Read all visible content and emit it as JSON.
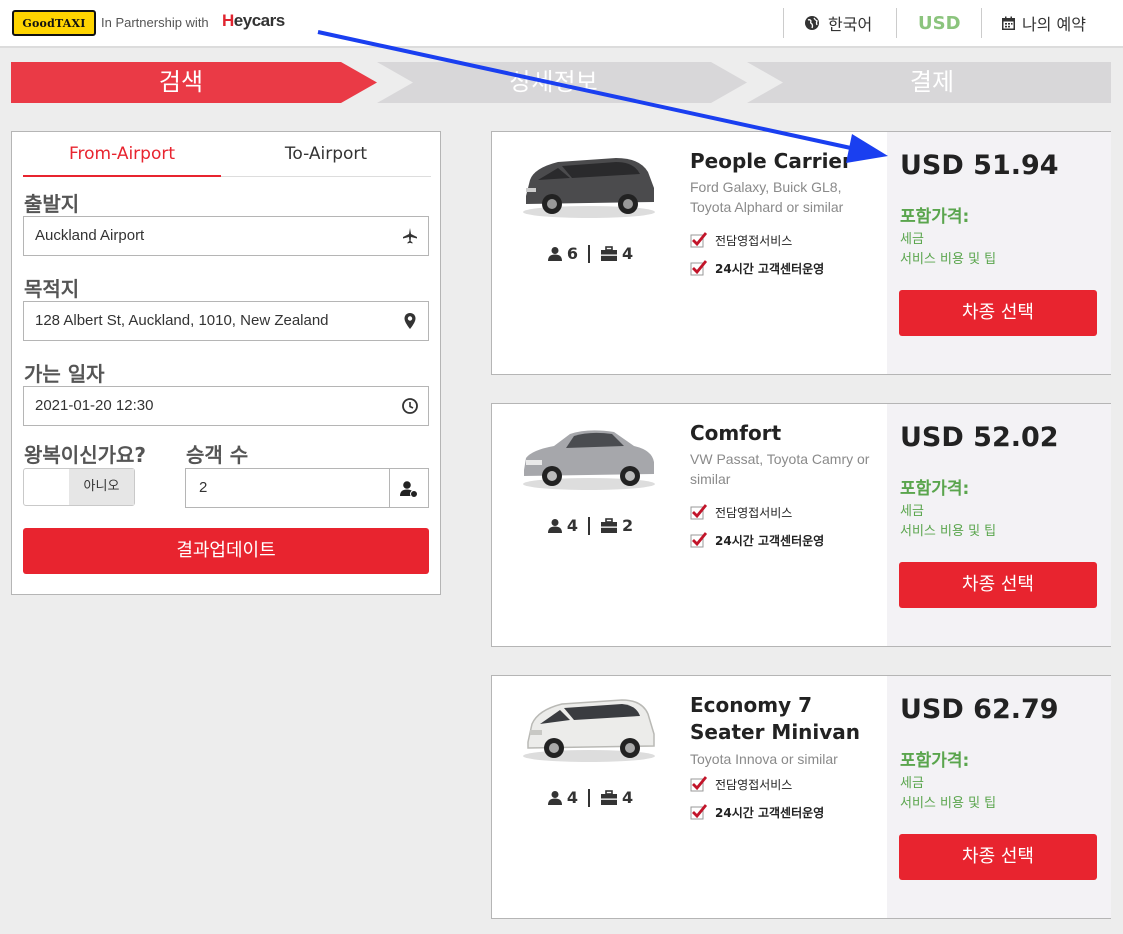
{
  "header": {
    "logo_text": "GoodTAXI",
    "partner_text": "In Partnership with",
    "partner_brand_first": "H",
    "partner_brand_rest": "eycars",
    "language": "한국어",
    "currency": "USD",
    "my_booking": "나의 예약",
    "currency_color": "#8bc47d"
  },
  "steps": [
    "검색",
    "상세정보",
    "결제"
  ],
  "form": {
    "tabs": [
      "From-Airport",
      "To-Airport"
    ],
    "active_tab": 0,
    "departure_label": "출발지",
    "departure_value": "Auckland Airport",
    "destination_label": "목적지",
    "destination_value": "128 Albert St, Auckland, 1010, New Zealand",
    "date_label": "가는 일자",
    "date_value": "2021-01-20 12:30",
    "roundtrip_label": "왕복이신가요?",
    "roundtrip_value": "아니오",
    "passengers_label": "승객 수",
    "passengers_value": "2",
    "update_button": "결과업데이트"
  },
  "cars": [
    {
      "name": "People Carrier",
      "desc": "Ford Galaxy, Buick GL8, Toyota Alphard or similar",
      "passengers": "6",
      "luggage": "4",
      "features": [
        "전담영접서비스",
        "24시간 고객센터운영"
      ],
      "price": "USD 51.94",
      "included_title": "포함가격:",
      "included": [
        "세금",
        "서비스 비용 및 팁"
      ],
      "select_button": "차종 선택"
    },
    {
      "name": "Comfort",
      "desc": "VW Passat, Toyota Camry or similar",
      "passengers": "4",
      "luggage": "2",
      "features": [
        "전담영접서비스",
        "24시간 고객센터운영"
      ],
      "price": "USD 52.02",
      "included_title": "포함가격:",
      "included": [
        "세금",
        "서비스 비용 및 팁"
      ],
      "select_button": "차종 선택"
    },
    {
      "name": "Economy 7 Seater Minivan",
      "desc": "Toyota Innova or similar",
      "passengers": "4",
      "luggage": "4",
      "features": [
        "전담영접서비스",
        "24시간 고객센터운영"
      ],
      "price": "USD 62.79",
      "included_title": "포함가격:",
      "included": [
        "세금",
        "서비스 비용 및 팁"
      ],
      "select_button": "차종 선택"
    }
  ],
  "colors": {
    "accent_red": "#e8242f",
    "step_inactive": "#d8d7d9",
    "included_green": "#5aa54d",
    "arrow_blue": "#1a3ff0"
  }
}
